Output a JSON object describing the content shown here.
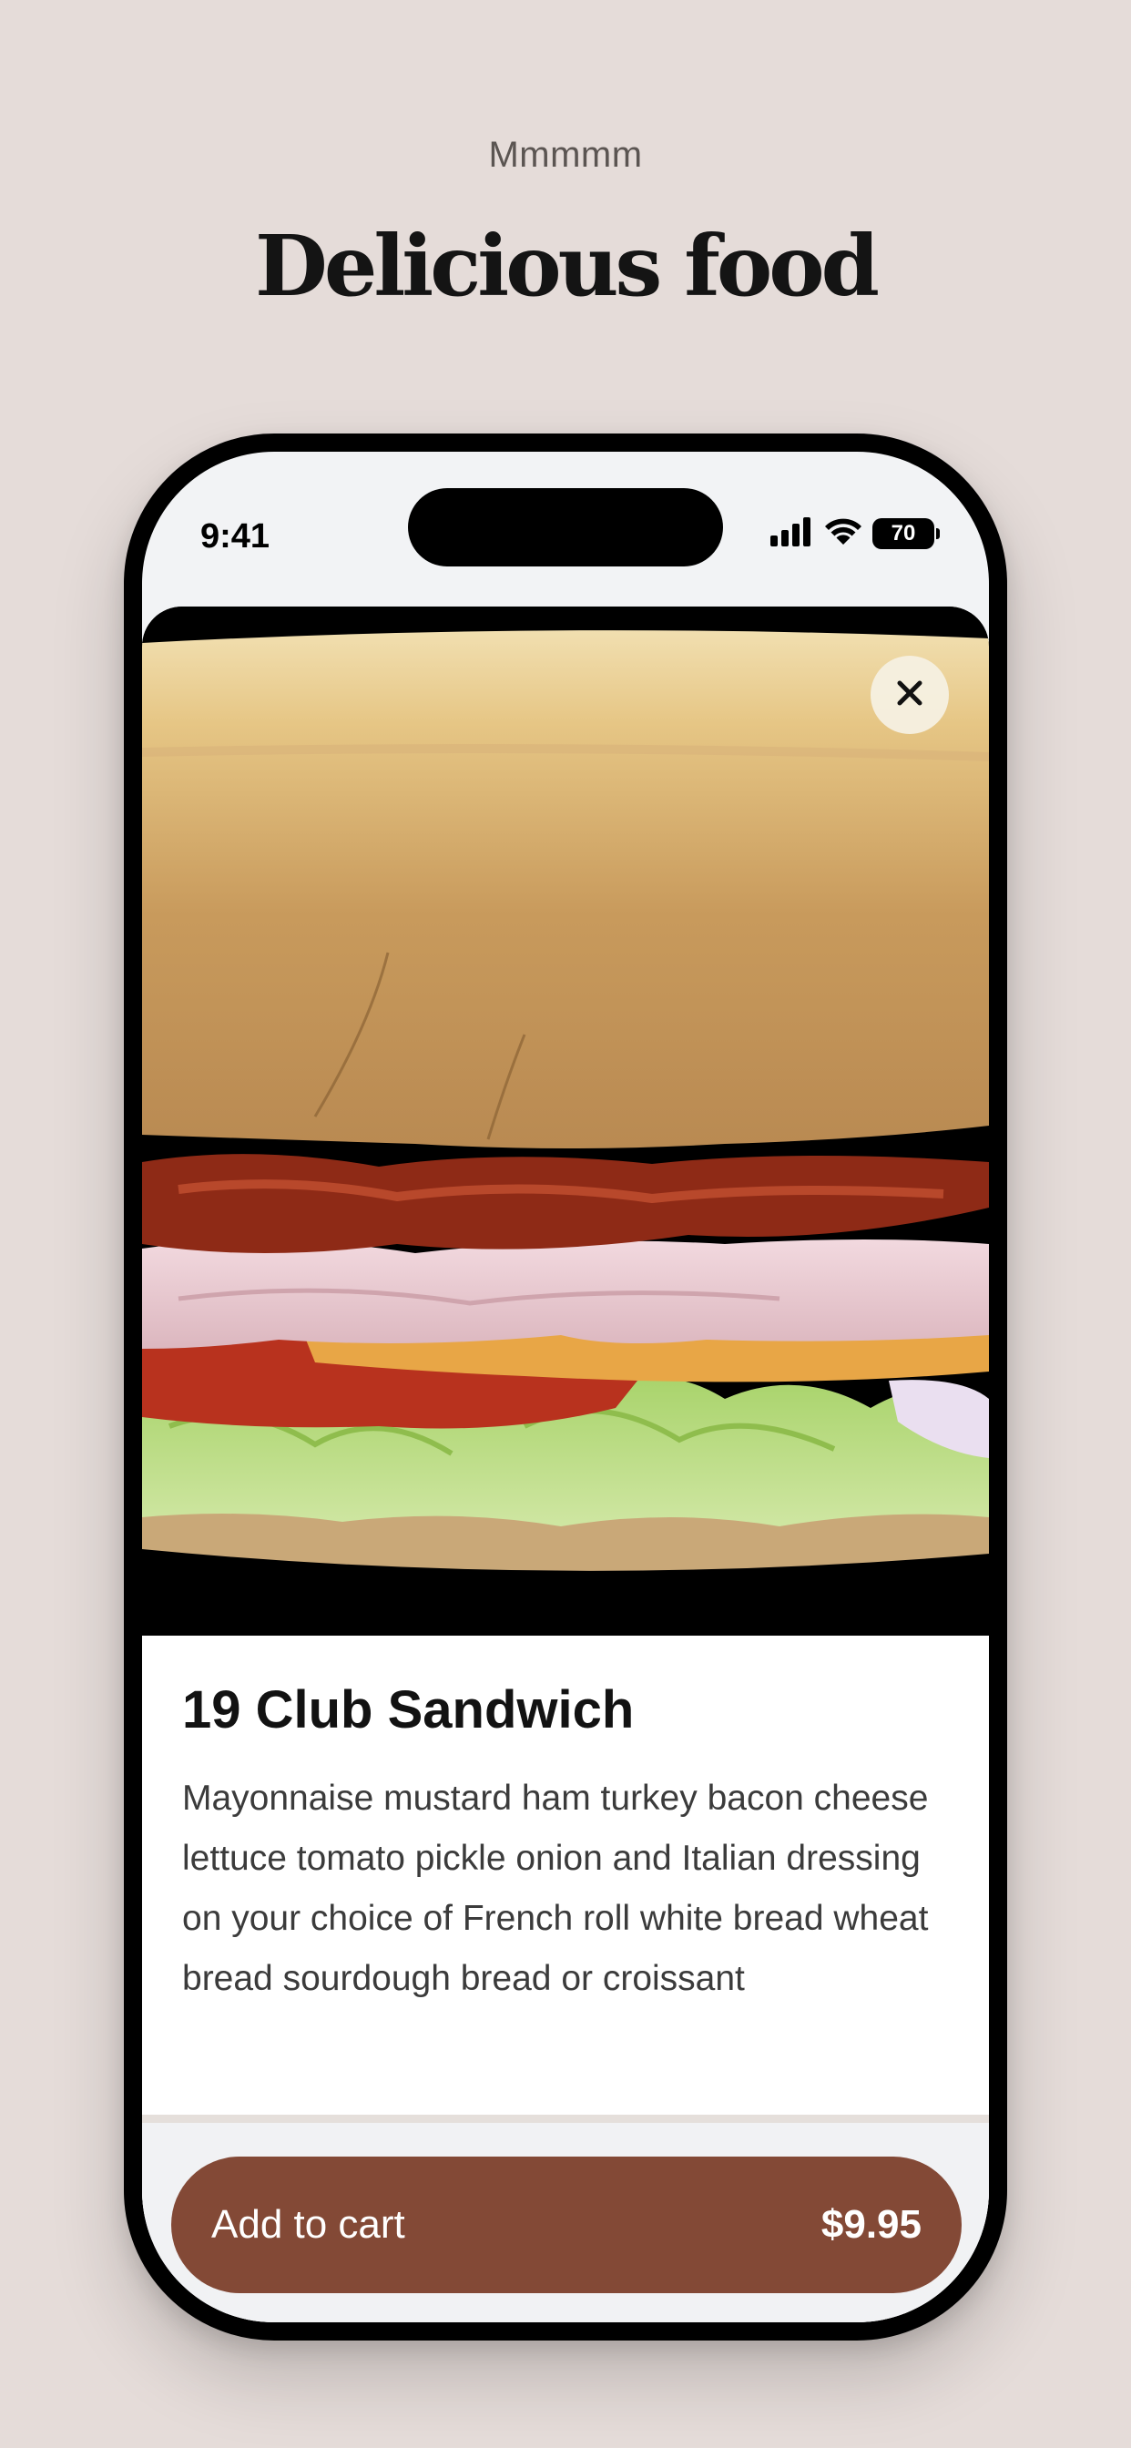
{
  "page": {
    "eyebrow": "Mmmmm",
    "headline": "Delicious food"
  },
  "status_bar": {
    "time": "9:41",
    "battery": "70",
    "icons": [
      "signal-icon",
      "wifi-icon",
      "battery-icon"
    ]
  },
  "product": {
    "image": "club-sandwich-photo",
    "name": "19 Club Sandwich",
    "description": "Mayonnaise mustard ham turkey bacon cheese lettuce tomato pickle onion and Italian dressing on your choice of French roll white bread wheat bread sourdough bread or croissant"
  },
  "actions": {
    "close_icon": "close-icon",
    "add_to_cart_label": "Add to cart",
    "price": "$9.95"
  },
  "colors": {
    "background": "#e5dcd9",
    "accent": "#834936",
    "phone_frame": "#000000"
  }
}
